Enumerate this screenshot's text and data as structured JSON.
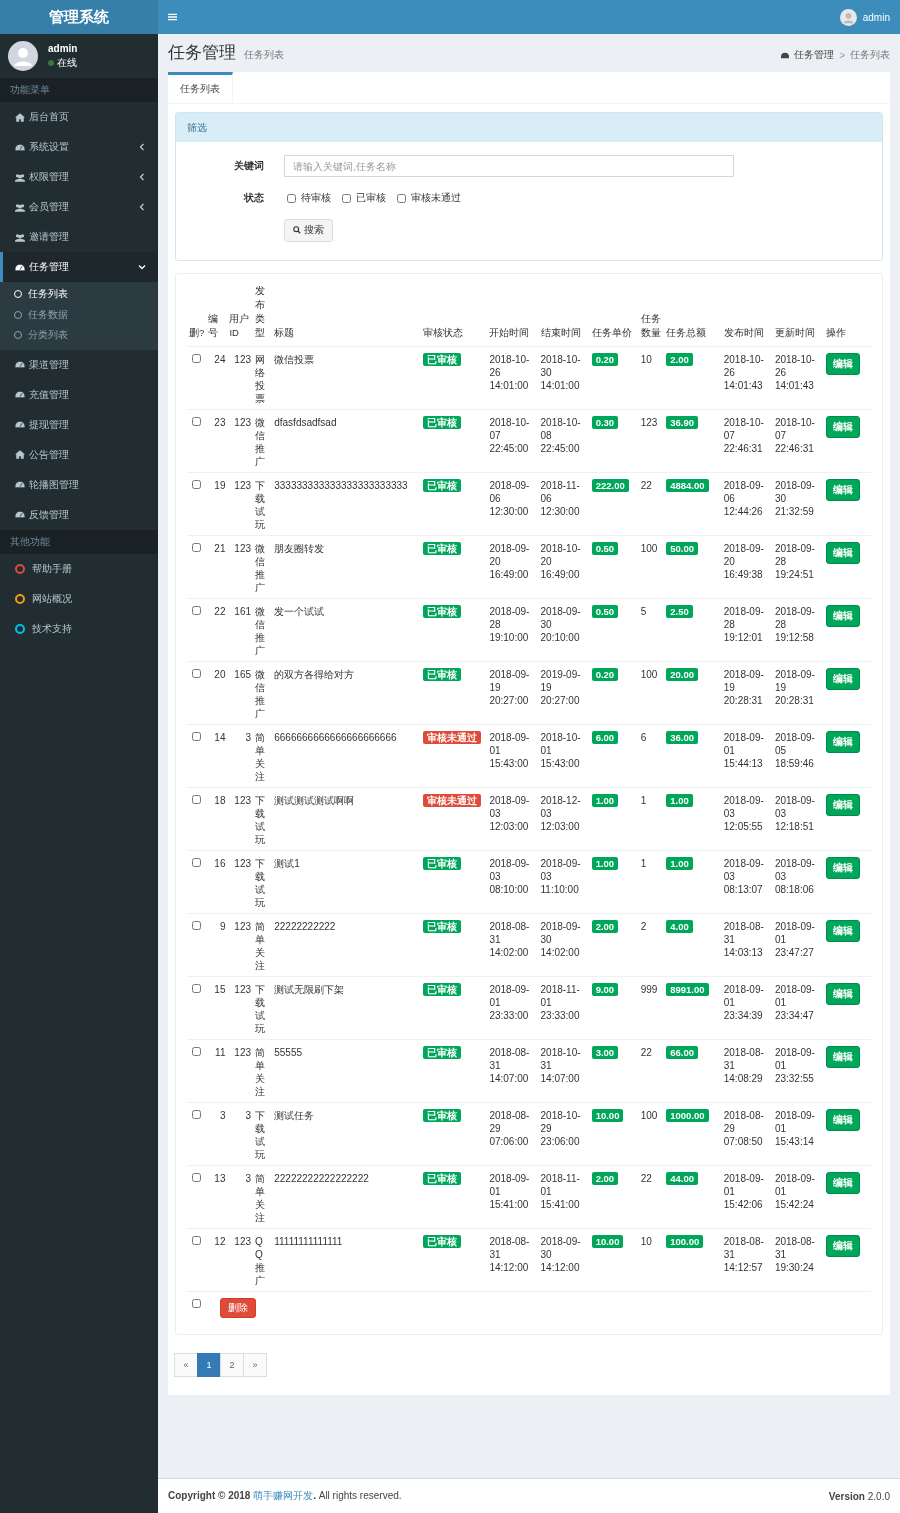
{
  "brand": "管理系统",
  "topbar": {
    "user": "admin"
  },
  "user_panel": {
    "name": "admin",
    "status": "在线"
  },
  "sidebar": {
    "sections": [
      {
        "header": "功能菜单",
        "items": [
          {
            "label": "后台首页",
            "kind": "home",
            "selected": false
          },
          {
            "label": "系统设置",
            "kind": "gauge",
            "expanded": false,
            "selected": false
          },
          {
            "label": "权限管理",
            "kind": "users",
            "expanded": false,
            "selected": false
          },
          {
            "label": "会员管理",
            "kind": "users",
            "expanded": false,
            "selected": false
          },
          {
            "label": "邀请管理",
            "kind": "users",
            "selected": false
          },
          {
            "label": "任务管理",
            "kind": "gauge",
            "expanded": true,
            "selected": true,
            "children": [
              {
                "label": "任务列表",
                "selected": true
              },
              {
                "label": "任务数据",
                "selected": false
              },
              {
                "label": "分类列表",
                "selected": false
              }
            ]
          },
          {
            "label": "渠道管理",
            "kind": "gauge",
            "selected": false
          },
          {
            "label": "充值管理",
            "kind": "gauge",
            "selected": false
          },
          {
            "label": "提现管理",
            "kind": "gauge",
            "selected": false
          },
          {
            "label": "公告管理",
            "kind": "home",
            "selected": false
          },
          {
            "label": "轮播图管理",
            "kind": "gauge",
            "selected": false
          },
          {
            "label": "反馈管理",
            "kind": "gauge",
            "selected": false
          }
        ]
      },
      {
        "header": "其他功能",
        "items": [
          {
            "label": "帮助手册",
            "kind": "circle",
            "color": "#dd4b39",
            "selected": false
          },
          {
            "label": "网站概况",
            "kind": "circle",
            "color": "#f39c12",
            "selected": false
          },
          {
            "label": "技术支持",
            "kind": "circle",
            "color": "#00c0ef",
            "selected": false
          }
        ]
      }
    ]
  },
  "page_header": {
    "title": "任务管理",
    "subtitle": "任务列表",
    "breadcrumb": [
      "任务管理",
      "任务列表"
    ],
    "breadcrumb_separator": ">"
  },
  "tabs": [
    {
      "label": "任务列表",
      "selected": true
    }
  ],
  "filter": {
    "title": "筛选",
    "keyword_label": "关键词",
    "placeholder": "请输入关键词,任务名称",
    "status_label": "状态",
    "options": [
      {
        "label": "待审核",
        "checked": false
      },
      {
        "label": "已审核",
        "checked": false
      },
      {
        "label": "审核未通过",
        "checked": false
      }
    ],
    "search_button": "搜索"
  },
  "table": {
    "columns": [
      "删?",
      "编号",
      "用户ID",
      "发布类型",
      "标题",
      "审核状态",
      "开始时间",
      "结束时间",
      "任务单价",
      "任务数量",
      "任务总额",
      "发布时间",
      "更新时间",
      "操作"
    ],
    "rows": [
      {
        "checked": false,
        "id": "24",
        "user_id": "123",
        "type": "网络投票",
        "title": "微信投票",
        "status": {
          "label": "已审核",
          "kind": "approved"
        },
        "start": "2018-10-26 14:01:00",
        "end": "2018-10-30 14:01:00",
        "price": "0.20",
        "quantity": "10",
        "total": "2.00",
        "published": "2018-10-26 14:01:43",
        "updated": "2018-10-26 14:01:43",
        "action": "编辑"
      },
      {
        "checked": false,
        "id": "23",
        "user_id": "123",
        "type": "微信推广",
        "title": "dfasfdsadfsad",
        "status": {
          "label": "已审核",
          "kind": "approved"
        },
        "start": "2018-10-07 22:45:00",
        "end": "2018-10-08 22:45:00",
        "price": "0.30",
        "quantity": "123",
        "total": "36.90",
        "published": "2018-10-07 22:46:31",
        "updated": "2018-10-07 22:46:31",
        "action": "编辑"
      },
      {
        "checked": false,
        "id": "19",
        "user_id": "123",
        "type": "下载试玩",
        "title": "333333333333333333333333",
        "status": {
          "label": "已审核",
          "kind": "approved"
        },
        "start": "2018-09-06 12:30:00",
        "end": "2018-11-06 12:30:00",
        "price": "222.00",
        "quantity": "22",
        "total": "4884.00",
        "published": "2018-09-06 12:44:26",
        "updated": "2018-09-30 21:32:59",
        "action": "编辑"
      },
      {
        "checked": false,
        "id": "21",
        "user_id": "123",
        "type": "微信推广",
        "title": "朋友圈转发",
        "status": {
          "label": "已审核",
          "kind": "approved"
        },
        "start": "2018-09-20 16:49:00",
        "end": "2018-10-20 16:49:00",
        "price": "0.50",
        "quantity": "100",
        "total": "50.00",
        "published": "2018-09-20 16:49:38",
        "updated": "2018-09-28 19:24:51",
        "action": "编辑"
      },
      {
        "checked": false,
        "id": "22",
        "user_id": "161",
        "type": "微信推广",
        "title": "发一个试试",
        "status": {
          "label": "已审核",
          "kind": "approved"
        },
        "start": "2018-09-28 19:10:00",
        "end": "2018-09-30 20:10:00",
        "price": "0.50",
        "quantity": "5",
        "total": "2.50",
        "published": "2018-09-28 19:12:01",
        "updated": "2018-09-28 19:12:58",
        "action": "编辑"
      },
      {
        "checked": false,
        "id": "20",
        "user_id": "165",
        "type": "微信推广",
        "title": "的双方各得给对方",
        "status": {
          "label": "已审核",
          "kind": "approved"
        },
        "start": "2018-09-19 20:27:00",
        "end": "2019-09-19 20:27:00",
        "price": "0.20",
        "quantity": "100",
        "total": "20.00",
        "published": "2018-09-19 20:28:31",
        "updated": "2018-09-19 20:28:31",
        "action": "编辑"
      },
      {
        "checked": false,
        "id": "14",
        "user_id": "3",
        "type": "简单关注",
        "title": "6666666666666666666666",
        "status": {
          "label": "审核未通过",
          "kind": "rejected"
        },
        "start": "2018-09-01 15:43:00",
        "end": "2018-10-01 15:43:00",
        "price": "6.00",
        "quantity": "6",
        "total": "36.00",
        "published": "2018-09-01 15:44:13",
        "updated": "2018-09-05 18:59:46",
        "action": "编辑"
      },
      {
        "checked": false,
        "id": "18",
        "user_id": "123",
        "type": "下载试玩",
        "title": "测试测试测试啊啊",
        "status": {
          "label": "审核未通过",
          "kind": "rejected"
        },
        "start": "2018-09-03 12:03:00",
        "end": "2018-12-03 12:03:00",
        "price": "1.00",
        "quantity": "1",
        "total": "1.00",
        "published": "2018-09-03 12:05:55",
        "updated": "2018-09-03 12:18:51",
        "action": "编辑"
      },
      {
        "checked": false,
        "id": "16",
        "user_id": "123",
        "type": "下载试玩",
        "title": "测试1",
        "status": {
          "label": "已审核",
          "kind": "approved"
        },
        "start": "2018-09-03 08:10:00",
        "end": "2018-09-03 11:10:00",
        "price": "1.00",
        "quantity": "1",
        "total": "1.00",
        "published": "2018-09-03 08:13:07",
        "updated": "2018-09-03 08:18:06",
        "action": "编辑"
      },
      {
        "checked": false,
        "id": "9",
        "user_id": "123",
        "type": "简单关注",
        "title": "22222222222",
        "status": {
          "label": "已审核",
          "kind": "approved"
        },
        "start": "2018-08-31 14:02:00",
        "end": "2018-09-30 14:02:00",
        "price": "2.00",
        "quantity": "2",
        "total": "4.00",
        "published": "2018-08-31 14:03:13",
        "updated": "2018-09-01 23:47:27",
        "action": "编辑"
      },
      {
        "checked": false,
        "id": "15",
        "user_id": "123",
        "type": "下载试玩",
        "title": "测试无限刷下架",
        "status": {
          "label": "已审核",
          "kind": "approved"
        },
        "start": "2018-09-01 23:33:00",
        "end": "2018-11-01 23:33:00",
        "price": "9.00",
        "quantity": "999",
        "total": "8991.00",
        "published": "2018-09-01 23:34:39",
        "updated": "2018-09-01 23:34:47",
        "action": "编辑"
      },
      {
        "checked": false,
        "id": "11",
        "user_id": "123",
        "type": "简单关注",
        "title": "55555",
        "status": {
          "label": "已审核",
          "kind": "approved"
        },
        "start": "2018-08-31 14:07:00",
        "end": "2018-10-31 14:07:00",
        "price": "3.00",
        "quantity": "22",
        "total": "66.00",
        "published": "2018-08-31 14:08:29",
        "updated": "2018-09-01 23:32:55",
        "action": "编辑"
      },
      {
        "checked": false,
        "id": "3",
        "user_id": "3",
        "type": "下载试玩",
        "title": "测试任务",
        "status": {
          "label": "已审核",
          "kind": "approved"
        },
        "start": "2018-08-29 07:06:00",
        "end": "2018-10-29 23:06:00",
        "price": "10.00",
        "quantity": "100",
        "total": "1000.00",
        "published": "2018-08-29 07:08:50",
        "updated": "2018-09-01 15:43:14",
        "action": "编辑"
      },
      {
        "checked": false,
        "id": "13",
        "user_id": "3",
        "type": "简单关注",
        "title": "22222222222222222",
        "status": {
          "label": "已审核",
          "kind": "approved"
        },
        "start": "2018-09-01 15:41:00",
        "end": "2018-11-01 15:41:00",
        "price": "2.00",
        "quantity": "22",
        "total": "44.00",
        "published": "2018-09-01 15:42:06",
        "updated": "2018-09-01 15:42:24",
        "action": "编辑"
      },
      {
        "checked": false,
        "id": "12",
        "user_id": "123",
        "type": "QQ推广",
        "title": "11111111111111",
        "status": {
          "label": "已审核",
          "kind": "approved"
        },
        "start": "2018-08-31 14:12:00",
        "end": "2018-09-30 14:12:00",
        "price": "10.00",
        "quantity": "10",
        "total": "100.00",
        "published": "2018-08-31 14:12:57",
        "updated": "2018-08-31 19:30:24",
        "action": "编辑"
      }
    ],
    "select_all_checked": false,
    "delete_button": "删除"
  },
  "pagination": {
    "prev": "«",
    "pages": [
      {
        "label": "1",
        "selected": true
      },
      {
        "label": "2",
        "selected": false
      }
    ],
    "next": "»"
  },
  "footer": {
    "copyright": "Copyright © 2018",
    "link": "萌手赚网开发",
    "suffix": ". All rights reserved.",
    "version": "**Version** 2.0.0"
  }
}
